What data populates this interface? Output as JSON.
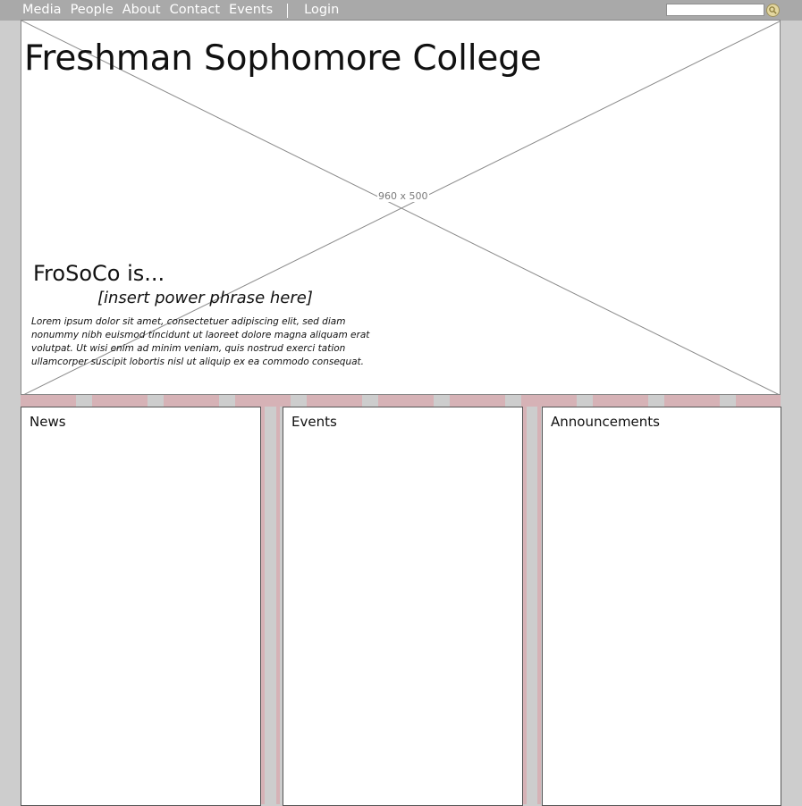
{
  "nav": {
    "items": [
      "Media",
      "People",
      "About",
      "Contact",
      "Events"
    ],
    "login": "Login"
  },
  "search": {
    "value": ""
  },
  "hero": {
    "site_title": "Freshman Sophomore College",
    "image_placeholder": "960 x 500",
    "tag_heading": "FroSoCo is...",
    "power_phrase": "[insert power phrase here]",
    "lorem": "Lorem ipsum dolor sit amet, consectetuer adipiscing elit, sed diam nonummy nibh euismod tincidunt ut laoreet dolore magna aliquam erat volutpat. Ut wisi enim ad minim veniam, quis nostrud exerci tation ullamcorper suscipit lobortis nisl ut aliquip ex ea commodo consequat."
  },
  "panels": {
    "news": "News",
    "events": "Events",
    "announcements": "Announcements"
  },
  "colors": {
    "background": "#cdcdcd",
    "topbar": "#a9a9a9",
    "stripe": "#d6b2b6"
  }
}
